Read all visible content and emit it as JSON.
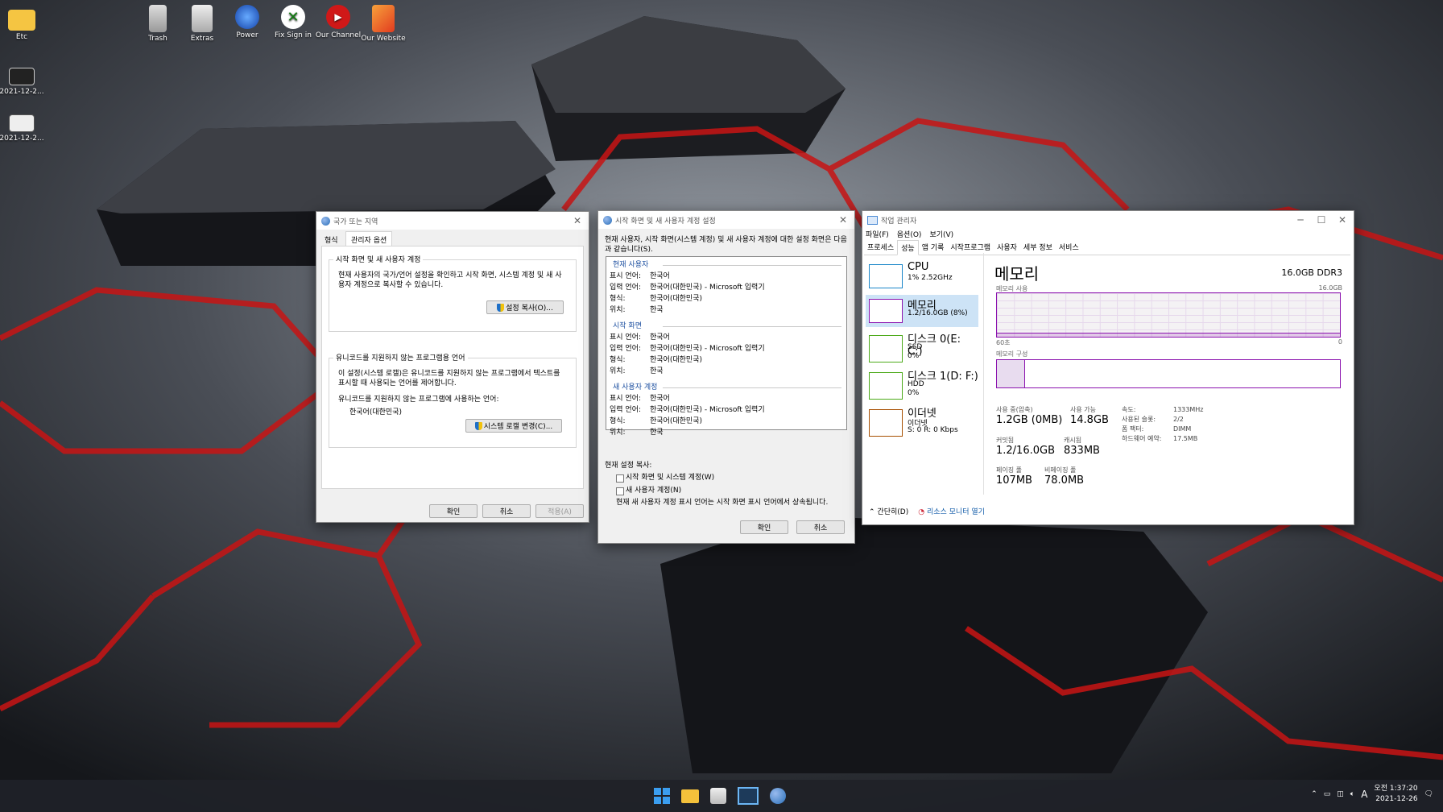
{
  "desktop": {
    "icons": [
      {
        "label": "Etc"
      },
      {
        "label": "Trash"
      },
      {
        "label": "Extras"
      },
      {
        "label": "Power"
      },
      {
        "label": "Fix Sign in"
      },
      {
        "label": "Our Channel"
      },
      {
        "label": "Our Website"
      },
      {
        "label": "2021-12-2..."
      },
      {
        "label": "2021-12-2..."
      }
    ]
  },
  "region": {
    "title": "국가 또는 지역",
    "tabs": [
      "형식",
      "관리자 옵션"
    ],
    "group1_label": "시작 화면 및 새 사용자 계정",
    "group1_text": "현재 사용자의 국가/언어 설정을 확인하고 시작 화면, 시스템 계정 및 새 사용자 계정으로 복사할 수 있습니다.",
    "copy_button": "설정 복사(O)...",
    "group2_label": "유니코드를 지원하지 않는 프로그램용 언어",
    "group2_text": "이 설정(시스템 로캘)은 유니코드를 지원하지 않는 프로그램에서 텍스트를 표시할 때 사용되는 언어를 제어합니다.",
    "current_lang_label": "유니코드를 지원하지 않는 프로그램에 사용하는 언어:",
    "current_lang": "한국어(대한민국)",
    "locale_button": "시스템 로캘 변경(C)...",
    "ok": "확인",
    "cancel": "취소",
    "apply": "적용(A)"
  },
  "welcome": {
    "title": "시작 화면 및 새 사용자 계정 설정",
    "intro": "현재 사용자, 시작 화면(시스템 계정) 및 새 사용자 계정에 대한 설정 화면은 다음과 같습니다(S).",
    "sections": [
      {
        "header": "현재 사용자",
        "rows": [
          {
            "k": "표시 언어:",
            "v": "한국어"
          },
          {
            "k": "입력 언어:",
            "v": "한국어(대한민국) - Microsoft 입력기"
          },
          {
            "k": "형식:",
            "v": "한국어(대한민국)"
          },
          {
            "k": "위치:",
            "v": "한국"
          }
        ]
      },
      {
        "header": "시작 화면",
        "rows": [
          {
            "k": "표시 언어:",
            "v": "한국어"
          },
          {
            "k": "입력 언어:",
            "v": "한국어(대한민국) - Microsoft 입력기"
          },
          {
            "k": "형식:",
            "v": "한국어(대한민국)"
          },
          {
            "k": "위치:",
            "v": "한국"
          }
        ]
      },
      {
        "header": "새 사용자 계정",
        "rows": [
          {
            "k": "표시 언어:",
            "v": "한국어"
          },
          {
            "k": "입력 언어:",
            "v": "한국어(대한민국) - Microsoft 입력기"
          },
          {
            "k": "형식:",
            "v": "한국어(대한민국)"
          },
          {
            "k": "위치:",
            "v": "한국"
          }
        ]
      }
    ],
    "copy_to": "현재 설정 복사:",
    "cb1": "시작 화면 및 시스템 계정(W)",
    "cb2": "새 사용자 계정(N)",
    "note": "현재 새 사용자 계정 표시 언어는 시작 화면 표시 언어에서 상속됩니다.",
    "ok": "확인",
    "cancel": "취소"
  },
  "taskmgr": {
    "title": "작업 관리자",
    "menu": [
      "파일(F)",
      "옵션(O)",
      "보기(V)"
    ],
    "tabs": [
      "프로세스",
      "성능",
      "앱 기록",
      "시작프로그램",
      "사용자",
      "세부 정보",
      "서비스"
    ],
    "sidebar": [
      {
        "name": "CPU",
        "sub1": "1% 2.52GHz",
        "sub2": ""
      },
      {
        "name": "메모리",
        "sub1": "1.2/16.0GB (8%)",
        "sub2": ""
      },
      {
        "name": "디스크 0(E: C:)",
        "sub1": "SSD",
        "sub2": "0%"
      },
      {
        "name": "디스크 1(D: F:)",
        "sub1": "HDD",
        "sub2": "0%"
      },
      {
        "name": "이더넷",
        "sub1": "이더넷",
        "sub2": "S: 0 R: 0 Kbps"
      }
    ],
    "heading": "메모리",
    "capacity": "16.0GB DDR3",
    "usage_label": "메모리 사용",
    "usage_max": "16.0GB",
    "axis_left": "60초",
    "axis_right": "0",
    "composition_label": "메모리 구성",
    "stats": {
      "in_use_label": "사용 중(압축)",
      "in_use": "1.2GB (0MB)",
      "available_label": "사용 가능",
      "available": "14.8GB",
      "committed_label": "커밋됨",
      "committed": "1.2/16.0GB",
      "cached_label": "캐시됨",
      "cached": "833MB",
      "paged_label": "페이징 풀",
      "paged": "107MB",
      "nonpaged_label": "비페이징 풀",
      "nonpaged": "78.0MB"
    },
    "props": [
      {
        "k": "속도:",
        "v": "1333MHz"
      },
      {
        "k": "사용된 슬롯:",
        "v": "2/2"
      },
      {
        "k": "폼 팩터:",
        "v": "DIMM"
      },
      {
        "k": "하드웨어 예약:",
        "v": "17.5MB"
      }
    ],
    "fewer": "간단히(D)",
    "resmon": "리소스 모니터 열기"
  },
  "tray": {
    "ime": "A",
    "time_prefix": "오전",
    "time": "1:37:20",
    "date": "2021-12-26"
  }
}
